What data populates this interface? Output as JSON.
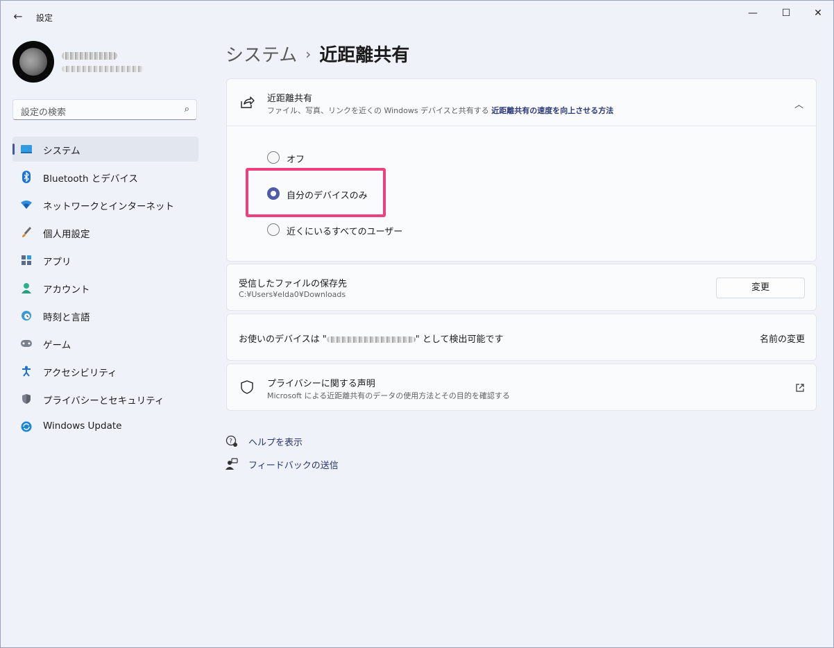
{
  "window": {
    "title": "設定",
    "back_icon": "back-arrow-icon",
    "controls": [
      "minimize-icon",
      "maximize-icon",
      "close-icon"
    ]
  },
  "search": {
    "placeholder": "設定の検索",
    "icon": "search-icon"
  },
  "sidebar": {
    "items": [
      {
        "label": "システム",
        "icon": "system-icon",
        "selected": true
      },
      {
        "label": "Bluetooth とデバイス",
        "icon": "bluetooth-icon"
      },
      {
        "label": "ネットワークとインターネット",
        "icon": "network-icon"
      },
      {
        "label": "個人用設定",
        "icon": "brush-icon"
      },
      {
        "label": "アプリ",
        "icon": "apps-icon"
      },
      {
        "label": "アカウント",
        "icon": "account-icon"
      },
      {
        "label": "時刻と言語",
        "icon": "time-language-icon"
      },
      {
        "label": "ゲーム",
        "icon": "gamepad-icon"
      },
      {
        "label": "アクセシビリティ",
        "icon": "accessibility-icon"
      },
      {
        "label": "プライバシーとセキュリティ",
        "icon": "shield-icon"
      },
      {
        "label": "Windows Update",
        "icon": "update-icon"
      }
    ]
  },
  "breadcrumb": {
    "parent": "システム",
    "separator": "›",
    "current": "近距離共有"
  },
  "nearby": {
    "title": "近距離共有",
    "subtitle": "ファイル、写真、リンクを近くの Windows デバイスと共有する",
    "link": "近距離共有の速度を向上させる方法",
    "icon": "share-icon",
    "options": [
      {
        "label": "オフ",
        "checked": false
      },
      {
        "label": "自分のデバイスのみ",
        "checked": true
      },
      {
        "label": "近くにいるすべてのユーザー",
        "checked": false
      }
    ]
  },
  "save_location": {
    "title": "受信したファイルの保存先",
    "path": "C:¥Users¥elda0¥Downloads",
    "button": "変更"
  },
  "discoverable": {
    "prefix": "お使いのデバイスは \"",
    "suffix": "\" として検出可能です",
    "action": "名前の変更"
  },
  "privacy": {
    "title": "プライバシーに関する声明",
    "subtitle": "Microsoft による近距離共有のデータの使用方法とその目的を確認する",
    "icon": "shield-outline-icon",
    "link_icon": "external-link-icon"
  },
  "footer": [
    {
      "label": "ヘルプを表示",
      "icon": "help-icon"
    },
    {
      "label": "フィードバックの送信",
      "icon": "feedback-icon"
    }
  ],
  "colors": {
    "accent": "#4e5ba8",
    "highlight": "#ee3f7e"
  }
}
